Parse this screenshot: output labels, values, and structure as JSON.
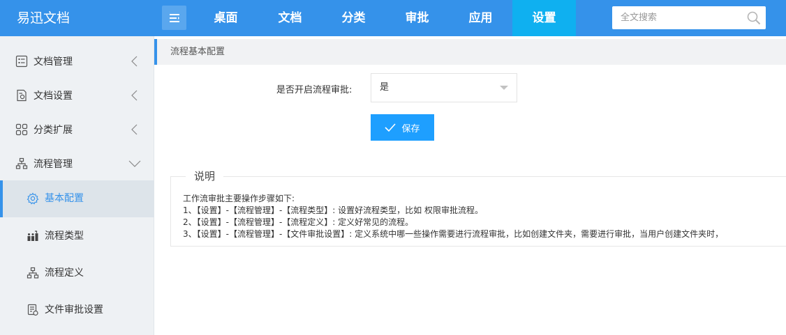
{
  "app": {
    "title": "易迅文档"
  },
  "header": {
    "nav": [
      "桌面",
      "文档",
      "分类",
      "审批",
      "应用",
      "设置"
    ],
    "active_nav": "设置",
    "search_placeholder": "全文搜索"
  },
  "sidebar": {
    "groups": [
      {
        "label": "文档管理",
        "icon": "list-icon",
        "state": "collapsed"
      },
      {
        "label": "文档设置",
        "icon": "doc-settings-icon",
        "state": "collapsed"
      },
      {
        "label": "分类扩展",
        "icon": "grid-icon",
        "state": "collapsed"
      },
      {
        "label": "流程管理",
        "icon": "org-tree-icon",
        "state": "expanded"
      }
    ],
    "sub_items": [
      {
        "label": "基本配置",
        "icon": "gear-icon",
        "active": true
      },
      {
        "label": "流程类型",
        "icon": "flow-type-icon",
        "active": false
      },
      {
        "label": "流程定义",
        "icon": "org-tree-icon",
        "active": false
      },
      {
        "label": "文件审批设置",
        "icon": "clipboard-icon",
        "active": false
      }
    ]
  },
  "main": {
    "breadcrumb": "流程基本配置",
    "form": {
      "enable_label": "是否开启流程审批:",
      "enable_value": "是",
      "save_label": "保存"
    },
    "notes": {
      "legend": "说明",
      "lines": [
        "工作流审批主要操作步骤如下:",
        "1、【设置】-【流程管理】-【流程类型】: 设置好流程类型，比如 权限审批流程。",
        "2、【设置】-【流程管理】-【流程定义】: 定义好常见的流程。",
        "3、【设置】-【流程管理】-【文件审批设置】: 定义系统中哪一些操作需要进行流程审批，比如创建文件夹，需要进行审批，当用户创建文件夹时，"
      ]
    }
  },
  "colors": {
    "primary": "#3592ea",
    "active_tab": "#0fb0f0",
    "button": "#1e9fff"
  }
}
